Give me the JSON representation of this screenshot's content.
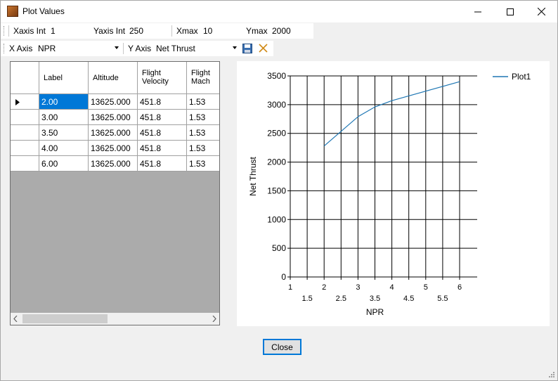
{
  "window": {
    "title": "Plot Values"
  },
  "toolbar1": {
    "xaxis_int_label": "Xaxis Int",
    "xaxis_int_value": "1",
    "yaxis_int_label": "Yaxis Int",
    "yaxis_int_value": "250",
    "xmax_label": "Xmax",
    "xmax_value": "10",
    "ymax_label": "Ymax",
    "ymax_value": "2000"
  },
  "toolbar2": {
    "x_axis_label": "X Axis",
    "x_axis_value": "NPR",
    "y_axis_label": "Y Axis",
    "y_axis_value": "Net Thrust"
  },
  "table": {
    "headers": [
      "Label",
      "Altitude",
      "Flight\nVelocity",
      "Flight\nMach"
    ],
    "rows": [
      [
        "2.00",
        "13625.000",
        "451.8",
        "1.53"
      ],
      [
        "3.00",
        "13625.000",
        "451.8",
        "1.53"
      ],
      [
        "3.50",
        "13625.000",
        "451.8",
        "1.53"
      ],
      [
        "4.00",
        "13625.000",
        "451.8",
        "1.53"
      ],
      [
        "6.00",
        "13625.000",
        "451.8",
        "1.53"
      ]
    ]
  },
  "chart_data": {
    "type": "line",
    "xlabel": "NPR",
    "ylabel": "Net Thrust",
    "xlim": [
      1,
      6
    ],
    "ylim": [
      0,
      3500
    ],
    "x_ticks_major": [
      "1",
      "2",
      "3",
      "4",
      "5",
      "6"
    ],
    "x_ticks_minor": [
      "1.5",
      "2.5",
      "3.5",
      "4.5",
      "5.5"
    ],
    "y_ticks": [
      "0",
      "500",
      "1000",
      "1500",
      "2000",
      "2500",
      "3000",
      "3500"
    ],
    "legend": "right",
    "grid": true,
    "series": [
      {
        "name": "Plot1",
        "color": "#1f77b4",
        "x": [
          2,
          3,
          3.5,
          4,
          6
        ],
        "y": [
          2280,
          2790,
          2960,
          3070,
          3400
        ]
      }
    ]
  },
  "buttons": {
    "close": "Close"
  }
}
